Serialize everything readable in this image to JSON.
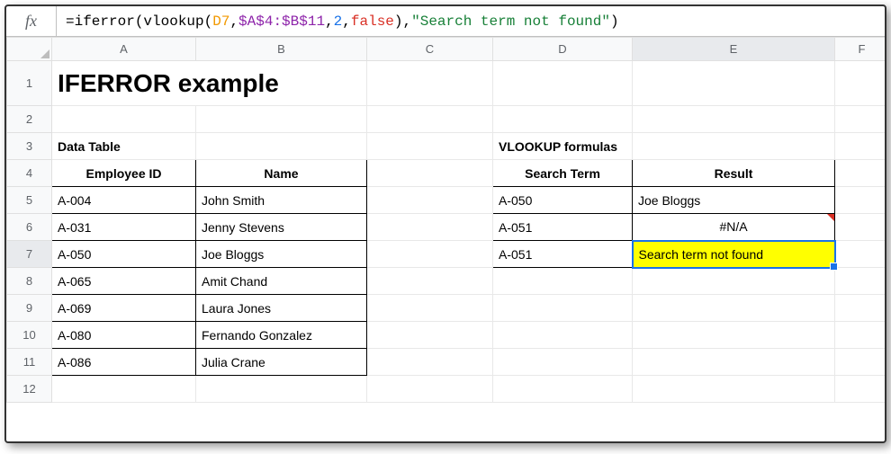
{
  "formula_bar": {
    "fx": "fx",
    "prefix": "=iferror(vlookup(",
    "ref1": "D7",
    "sep1": ",",
    "ref2": "$A$4:$B$11",
    "sep2": ",",
    "num": "2",
    "sep3": ",",
    "bool": "false",
    "mid": "),",
    "str": "\"Search term not found\"",
    "suffix": ")"
  },
  "columns": [
    "A",
    "B",
    "C",
    "D",
    "E",
    "F"
  ],
  "rows": [
    "1",
    "2",
    "3",
    "4",
    "5",
    "6",
    "7",
    "8",
    "9",
    "10",
    "11",
    "12"
  ],
  "title": "IFERROR example",
  "headers": {
    "data_table": "Data Table",
    "vlookup_formulas": "VLOOKUP formulas",
    "employee_id": "Employee ID",
    "name": "Name",
    "search_term": "Search Term",
    "result": "Result"
  },
  "employees": [
    {
      "id": "A-004",
      "name": "John Smith"
    },
    {
      "id": "A-031",
      "name": "Jenny Stevens"
    },
    {
      "id": "A-050",
      "name": "Joe Bloggs"
    },
    {
      "id": "A-065",
      "name": "Amit Chand"
    },
    {
      "id": "A-069",
      "name": "Laura Jones"
    },
    {
      "id": "A-080",
      "name": "Fernando Gonzalez"
    },
    {
      "id": "A-086",
      "name": "Julia Crane"
    }
  ],
  "lookups": [
    {
      "term": "A-050",
      "result": "Joe Bloggs"
    },
    {
      "term": "A-051",
      "result": "#N/A"
    },
    {
      "term": "A-051",
      "result": "Search term not found"
    }
  ],
  "selected_cell": "E7",
  "colors": {
    "highlight": "#ffff00",
    "selection": "#1a73e8"
  }
}
